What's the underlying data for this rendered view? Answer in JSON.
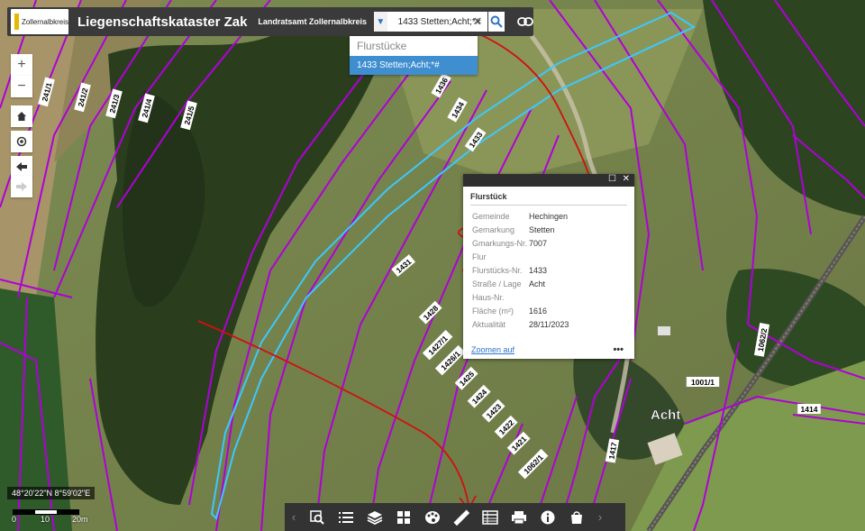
{
  "header": {
    "logo_text": "Zollernalbkreis",
    "title": "Liegenschaftskataster Zak",
    "subtitle": "Landratsamt Zollernalbkreis",
    "search_value": "1433 Stetten;Acht;*#"
  },
  "suggestions": {
    "header": "Flurstücke",
    "item": "1433 Stetten;Acht;*#"
  },
  "popup": {
    "heading": "Flurstück",
    "rows": [
      {
        "key": "Gemeinde",
        "value": "Hechingen"
      },
      {
        "key": "Gemarkung",
        "value": "Stetten"
      },
      {
        "key": "Gmarkungs-Nr.",
        "value": "7007"
      },
      {
        "key": "Flur",
        "value": ""
      },
      {
        "key": "Flurstücks-Nr.",
        "value": "1433"
      },
      {
        "key": "Straße / Lage",
        "value": "Acht"
      },
      {
        "key": "Haus-Nr.",
        "value": ""
      },
      {
        "key": "Fläche (m²)",
        "value": "1616"
      },
      {
        "key": "Aktualität",
        "value": "28/11/2023"
      }
    ],
    "zoom_link": "Zoomen auf",
    "more": "•••",
    "close": "✕",
    "maximize": "☐"
  },
  "map": {
    "place_label": "Acht",
    "parcel_labels": [
      "241/1",
      "241/2",
      "241/3",
      "241/4",
      "241/5",
      "1436",
      "1434",
      "1433",
      "1431",
      "1428",
      "1427/1",
      "1426/1",
      "1425",
      "1424",
      "1423",
      "1422",
      "1421",
      "1062/1",
      "1062/2",
      "1001/1",
      "1417",
      "1414"
    ],
    "colors": {
      "parcel": "#b000d8",
      "highlight": "#3cc8ff",
      "annotation": "#d01010"
    }
  },
  "status": {
    "coords": "48°20'22\"N 8°59'02\"E",
    "scale_labels": [
      "0",
      "10",
      "20m"
    ]
  },
  "controls": {
    "zoom_in": "+",
    "zoom_out": "−"
  },
  "toolbar": {
    "icons": [
      "search-map-icon",
      "legend-list-icon",
      "layers-icon",
      "grid-icon",
      "palette-icon",
      "ruler-icon",
      "table-icon",
      "print-icon",
      "info-icon",
      "bag-icon"
    ]
  }
}
